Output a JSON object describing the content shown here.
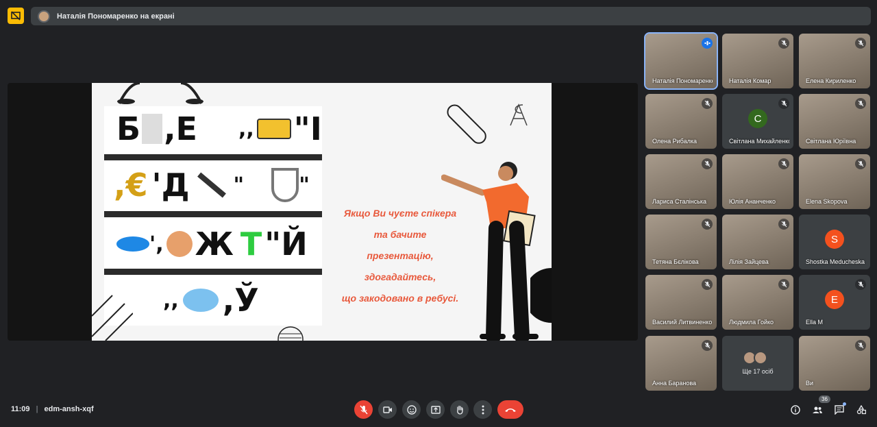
{
  "presentation": {
    "banner": "Наталія Пономаренко на екрані"
  },
  "slide": {
    "rebus_rows": [
      [
        "Б",
        ",Е",
        ",,",
        "\"І"
      ],
      [
        ",€",
        "'Д",
        "\"",
        "\""
      ],
      [
        "'",
        ",",
        "Ж",
        "Т",
        "\"Й"
      ],
      [
        ",,",
        ",Ў"
      ]
    ],
    "text_lines": [
      "Якщо Ви чуєте спікера",
      "та бачите",
      "презентацію,",
      "здогадайтесь,",
      "що закодовано в ребусі."
    ],
    "accent_color": "#e8593c"
  },
  "participants": [
    {
      "name": "Наталія Пономаренко",
      "state": "speaking"
    },
    {
      "name": "Наталія Комар",
      "state": "muted"
    },
    {
      "name": "Елена Кириленко",
      "state": "muted"
    },
    {
      "name": "Олена Рибалка",
      "state": "muted"
    },
    {
      "name": "Світлана Михайленко",
      "state": "muted",
      "letter": "С",
      "color": "#33691e"
    },
    {
      "name": "Світлана Юріївна",
      "state": "muted"
    },
    {
      "name": "Лариса Сталінська",
      "state": "muted"
    },
    {
      "name": "Юлія Ананченко",
      "state": "muted"
    },
    {
      "name": "Elena Skopova",
      "state": "muted"
    },
    {
      "name": "Тетяна Бєлікова",
      "state": "muted"
    },
    {
      "name": "Лілія Зайцева",
      "state": "muted"
    },
    {
      "name": "Shostka Meducheska",
      "state": "none",
      "letter": "S",
      "color": "#f4511e"
    },
    {
      "name": "Василий Литвиненко",
      "state": "muted"
    },
    {
      "name": "Людмила Гойко",
      "state": "muted"
    },
    {
      "name": "Ella M",
      "state": "muted",
      "letter": "E",
      "color": "#f4511e"
    },
    {
      "name": "Анна Баранова",
      "state": "muted"
    },
    {
      "name": "Ще 17 осіб",
      "state": "more"
    },
    {
      "name": "Ви",
      "state": "muted"
    }
  ],
  "bottom": {
    "time": "11:09",
    "separator": "|",
    "meeting_code": "edm-ansh-xqf",
    "participants_count": "36"
  }
}
